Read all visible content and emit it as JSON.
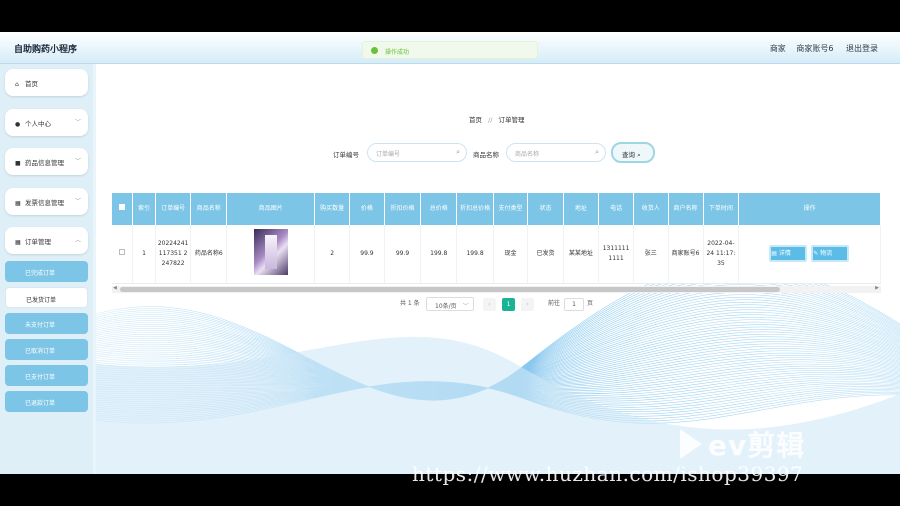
{
  "app_title": "自助购药小程序",
  "user": {
    "role": "商家",
    "name": "商家账号6",
    "logout": "退出登录"
  },
  "toast": "操作成功",
  "sidebar": {
    "items": [
      {
        "label": "首页",
        "icon": "home-icon"
      },
      {
        "label": "个人中心",
        "icon": "user-icon"
      },
      {
        "label": "药品信息管理",
        "icon": "box-icon"
      },
      {
        "label": "发票信息管理",
        "icon": "grid-icon"
      },
      {
        "label": "订单管理",
        "icon": "grid-icon"
      }
    ],
    "sub_items": [
      "已完成订单",
      "已发货订单",
      "未支付订单",
      "已取消订单",
      "已支付订单",
      "已退款订单"
    ],
    "active_sub": "已发货订单"
  },
  "breadcrumb": {
    "home": "首页",
    "sep": "//",
    "current": "订单管理"
  },
  "search": {
    "order_label": "订单编号",
    "order_placeholder": "订单编号",
    "product_label": "商品名称",
    "product_placeholder": "商品名称",
    "query_label": "查询"
  },
  "table": {
    "headers": [
      "索引",
      "订单编号",
      "商品名称",
      "商品图片",
      "购买数量",
      "价格",
      "折扣价格",
      "总价格",
      "折扣总价格",
      "支付类型",
      "状态",
      "地址",
      "电话",
      "收货人",
      "商户名称",
      "下单时间",
      "操作"
    ],
    "rows": [
      {
        "index": "1",
        "order_no": "20224241117351 2247822",
        "product": "药品名称6",
        "qty": "2",
        "price": "99.9",
        "discount_price": "99.9",
        "total": "199.8",
        "discount_total": "199.8",
        "pay_type": "现金",
        "status": "已发货",
        "address": "某某地址",
        "phone": "13111111111",
        "receiver": "张三",
        "merchant": "商家账号6",
        "order_time": "2022-04-24 11:17:35",
        "op_detail": "详情",
        "op_logistics": "物流"
      }
    ]
  },
  "pager": {
    "total": "共 1 条",
    "size": "10条/页",
    "page": "1",
    "goto_prefix": "前往",
    "goto_value": "1",
    "goto_suffix": "页"
  },
  "watermark": {
    "brand": "ev剪辑",
    "url": "https://www.huzhan.com/ishop39397"
  }
}
